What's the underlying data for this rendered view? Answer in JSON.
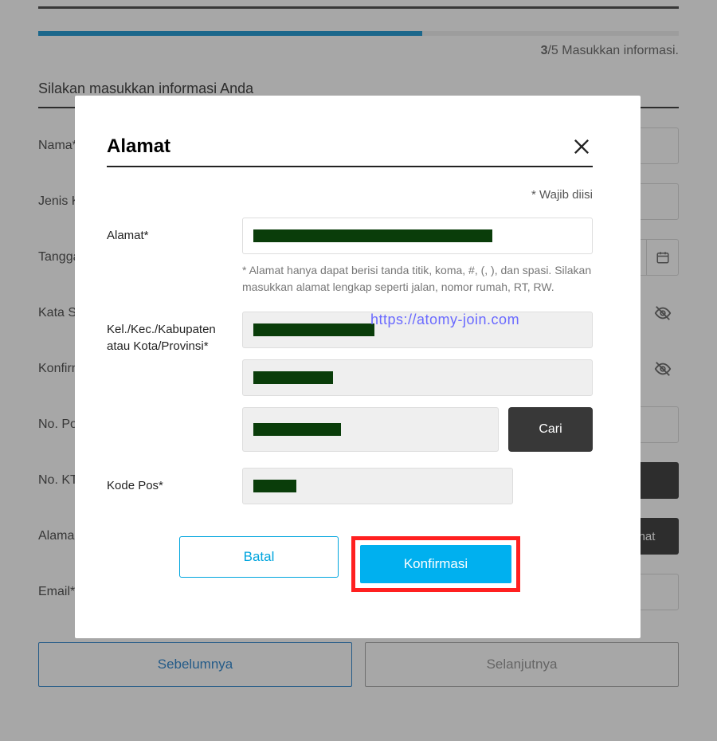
{
  "progress": {
    "step": 3,
    "total": 5,
    "label": "Masukkan informasi.",
    "percent": 60
  },
  "section_title": "Silakan masukkan informasi Anda",
  "bg_labels": {
    "nama": "Nama*",
    "jenis": "Jenis K",
    "tanggal": "Tangga",
    "katasandi": "Kata Sa",
    "konfirmasi": "Konfirm",
    "nopo": "No. Po",
    "noktp": "No. KT",
    "alamat": "Alama",
    "email": "Email*"
  },
  "bg_buttons": {
    "mat": "nat"
  },
  "nav": {
    "prev": "Sebelumnya",
    "next": "Selanjutnya"
  },
  "modal": {
    "title": "Alamat",
    "required_hint": "* Wajib diisi",
    "labels": {
      "alamat": "Alamat*",
      "kel": "Kel./Kec./Kabupaten atau Kota/Provinsi*",
      "kodepos": "Kode Pos*"
    },
    "help": "* Alamat hanya dapat berisi tanda titik, koma, #, (, ), dan spasi. Silakan masukkan alamat lengkap seperti jalan, nomor rumah, RT, RW.",
    "cari": "Cari",
    "batal": "Batal",
    "konfirmasi": "Konfirmasi"
  },
  "watermark": "https://atomy-join.com",
  "colors": {
    "accent": "#00b0ef",
    "progress": "#008acc",
    "highlight": "#ff2020",
    "dark_btn": "#383838"
  }
}
